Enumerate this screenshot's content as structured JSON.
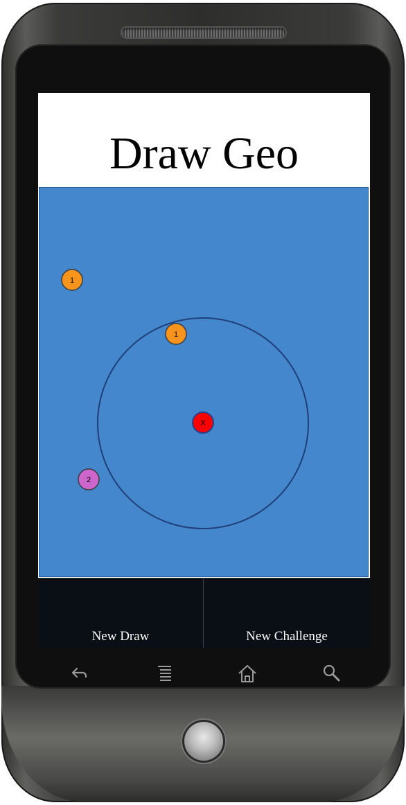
{
  "app": {
    "title": "Draw Geo"
  },
  "canvas": {
    "background_color": "#4487cc",
    "circle": {
      "stroke_color": "#1f3f7a"
    },
    "markers": [
      {
        "label": "1",
        "color": "#f7941d",
        "kind": "point-1"
      },
      {
        "label": "1",
        "color": "#f7941d",
        "kind": "point-1"
      },
      {
        "label": "2",
        "color": "#cc66cc",
        "kind": "point-2"
      },
      {
        "label": "X",
        "color": "#ff0000",
        "kind": "center"
      }
    ]
  },
  "buttons": {
    "new_draw": "New Draw",
    "new_challenge": "New Challenge"
  },
  "softkeys": [
    {
      "icon": "back-icon"
    },
    {
      "icon": "menu-icon"
    },
    {
      "icon": "home-icon"
    },
    {
      "icon": "search-icon"
    }
  ]
}
